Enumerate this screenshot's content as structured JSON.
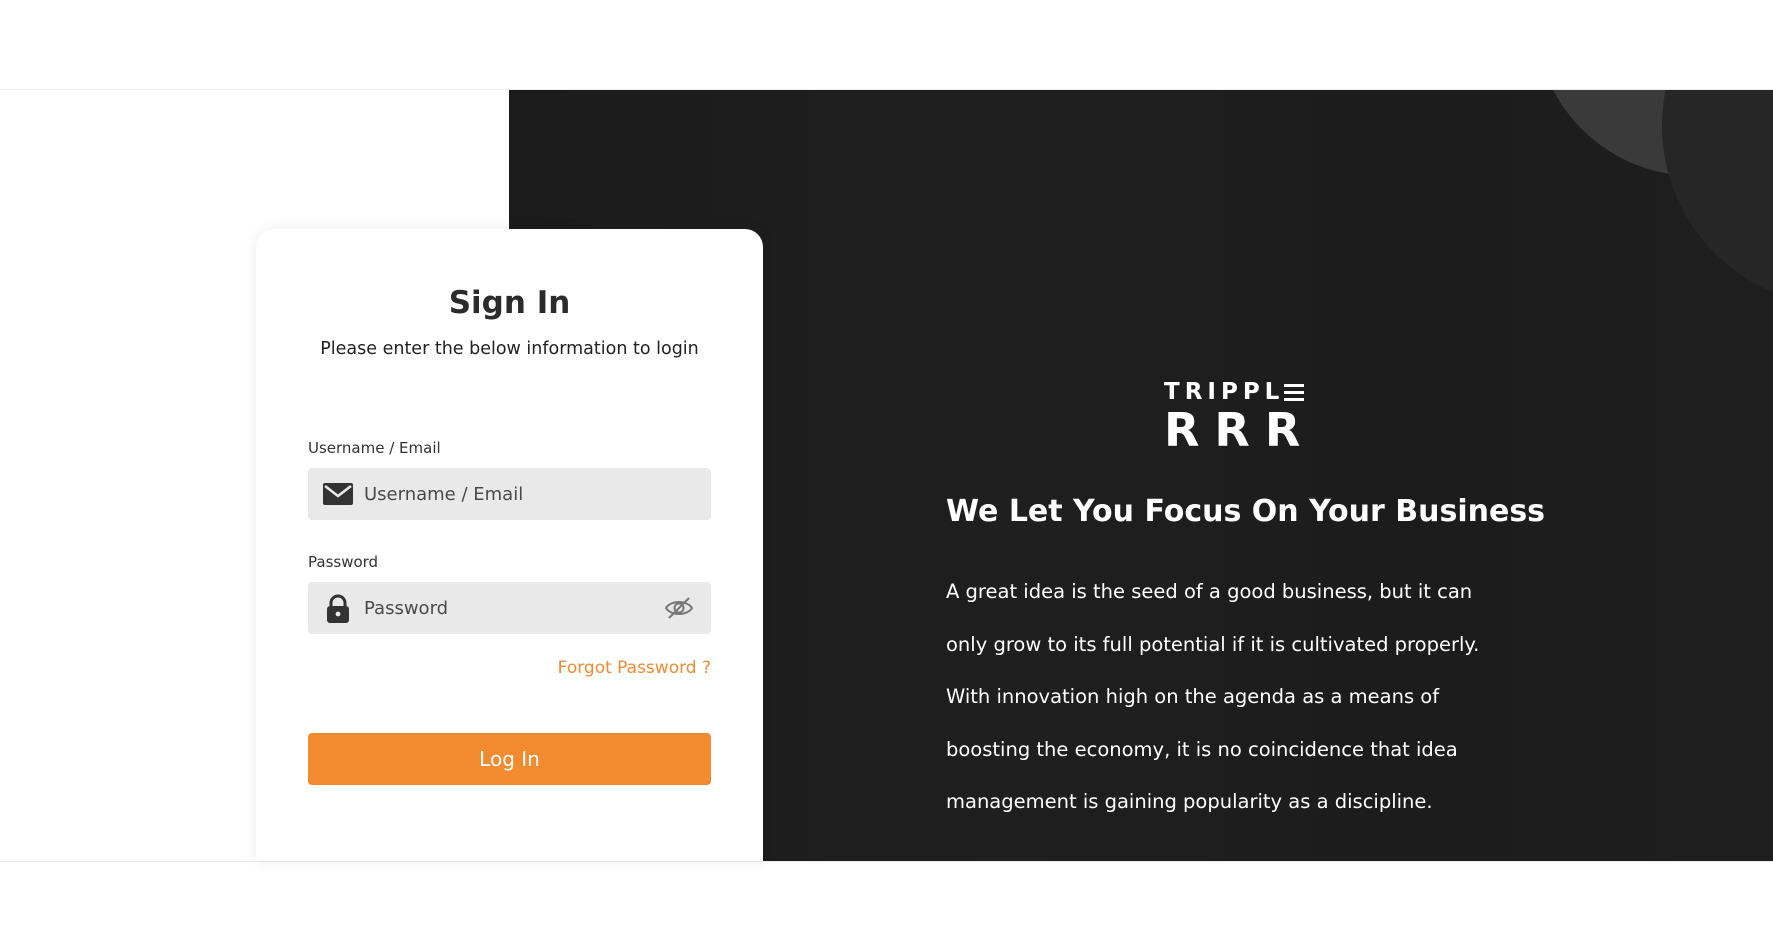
{
  "login": {
    "title": "Sign In",
    "subtitle": "Please enter the below information to login",
    "username": {
      "label": "Username / Email",
      "placeholder": "Username / Email",
      "value": "",
      "icon": "envelope-icon"
    },
    "password": {
      "label": "Password",
      "placeholder": "Password",
      "value": "",
      "icon": "lock-icon",
      "toggle_icon": "eye-slash-icon"
    },
    "forgot_label": "Forgot Password ?",
    "submit_label": "Log In"
  },
  "brand": {
    "logo_top": "TRIPPL",
    "logo_bottom": "RRR",
    "tagline": "We Let You Focus On Your Business",
    "body_lines": [
      "A great idea is the seed of a good business, but it can",
      "only grow to its full potential if it is cultivated properly.",
      "With innovation high on the agenda as a means of",
      "boosting the economy, it is no coincidence that idea",
      "management is gaining popularity as a discipline."
    ]
  },
  "colors": {
    "accent": "#f28a30",
    "dark_background": "#1e1e1e",
    "input_background": "#e9e9e9"
  }
}
